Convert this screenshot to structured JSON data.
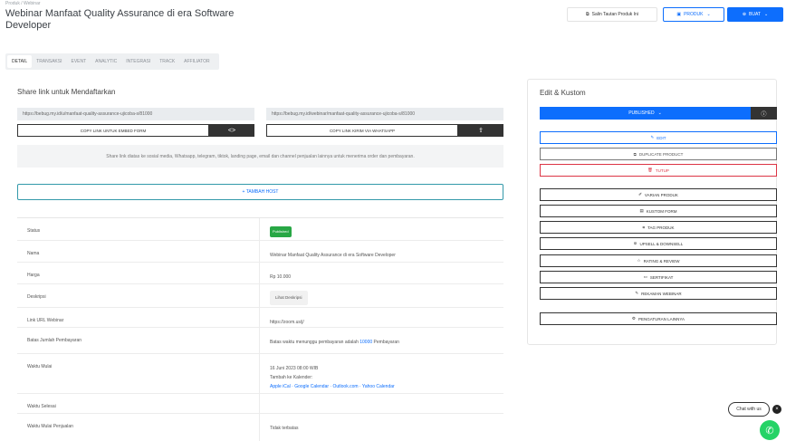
{
  "header": {
    "breadcrumb": "Produk / Webinar",
    "title": "Webinar Manfaat Quality Assurance di era Software Developer",
    "copy_link_label": "Salin Tautan Produk Ini",
    "produk_label": "PRODUK",
    "buat_label": "BUAT"
  },
  "tabs": [
    "DETAIL",
    "TRANSAKSI",
    "EVENT",
    "ANALYTIC",
    "INTEGRASI",
    "TRACK",
    "AFFILIATOR"
  ],
  "share": {
    "title": "Share link untuk Mendaftarkan",
    "link_1": "https://bebug.my.id/u/manfaat-quality-assurance-ujicoba-s/81000",
    "link_2": "https://bebug.my.id/webinar/manfaat-quality-assurance-ujicoba-s/81000",
    "copy_embed_label": "COPY LINK UNTUK EMBED FORM",
    "copy_wa_label": "COPY LINK KIRIM VIA WHATSAPP",
    "embed_icon": "<>",
    "share_icon": "⇪",
    "notice": "Share link diatas ke sosial media, Whatsapp, telegram, tiktok, landing page, email dan channel penjualan lainnya untuk menerima order dan pembayaran."
  },
  "add_host_label": "+ TAMBAH HOST",
  "details": {
    "status_key": "Status",
    "status_value": "Published",
    "nama_key": "Nama",
    "nama_value": "Webinar Manfaat Quality Assurance di era Software Developer",
    "harga_key": "Harga",
    "harga_value": "Rp 10.000",
    "deskripsi_key": "Deskripsi",
    "deskripsi_value": "Lihat Deskripsi",
    "link_key": "Link URL Webinar",
    "link_value": "https://zoom.us/j/",
    "batas_key": "Batas Jumlah Pembayaran",
    "batas_value_pre": "Batas waktu menunggu pembayaran adalah",
    "batas_value_link": "10000",
    "batas_value_post": "Pembayaran",
    "waktu_mulai_key": "Waktu Mulai",
    "waktu_mulai_value": "16 Juni 2023 08:00 WIB",
    "calendar_note": "Tambah ke Kalender:",
    "calendar_links": "Apple iCal · Google Calendar · Outlook.com · Yahoo Calendar",
    "waktu_selesai_key": "Waktu Selesai",
    "waktu_penjualan_key": "Waktu Mulai Penjualan",
    "waktu_penjualan_value": "Tidak terbatas"
  },
  "edit_panel": {
    "title": "Edit & Kustom",
    "published_label": "PUBLISHED",
    "edit_label": "EDIT",
    "duplicate_label": "DUPLICATE PRODUCT",
    "tutup_label": "TUTUP",
    "varian_label": "VARIAN PRODUK",
    "custom_form_label": "KUSTOM FORM",
    "tag_label": "TAG PRODUK",
    "upsell_label": "UPSELL & DOWNSELL",
    "rating_label": "RATING & REVIEW",
    "sertifikat_label": "SERTIFIKAT",
    "rekaman_label": "REKAMAN WEBINAR",
    "pengaturan_label": "PENGATURAN LAINNYA"
  },
  "chat": {
    "label": "Chat with us",
    "close": "×"
  },
  "colors": {
    "primary": "#0d6efd",
    "danger": "#dc3545",
    "success": "#28a745",
    "dark": "#333333"
  }
}
